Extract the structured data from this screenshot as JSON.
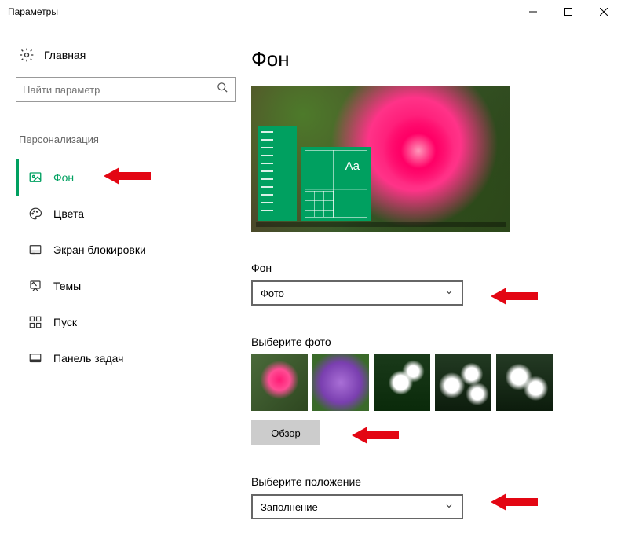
{
  "window": {
    "title": "Параметры"
  },
  "sidebar": {
    "home": "Главная",
    "search_placeholder": "Найти параметр",
    "category": "Персонализация",
    "items": [
      {
        "label": "Фон",
        "active": true
      },
      {
        "label": "Цвета"
      },
      {
        "label": "Экран блокировки"
      },
      {
        "label": "Темы"
      },
      {
        "label": "Пуск"
      },
      {
        "label": "Панель задач"
      }
    ]
  },
  "main": {
    "title": "Фон",
    "preview_sample_text": "Aa",
    "bg_label": "Фон",
    "bg_dropdown_value": "Фото",
    "choose_photo_label": "Выберите фото",
    "browse_button": "Обзор",
    "position_label": "Выберите положение",
    "position_dropdown_value": "Заполнение"
  },
  "colors": {
    "accent": "#00a060",
    "arrow": "#e30613"
  }
}
